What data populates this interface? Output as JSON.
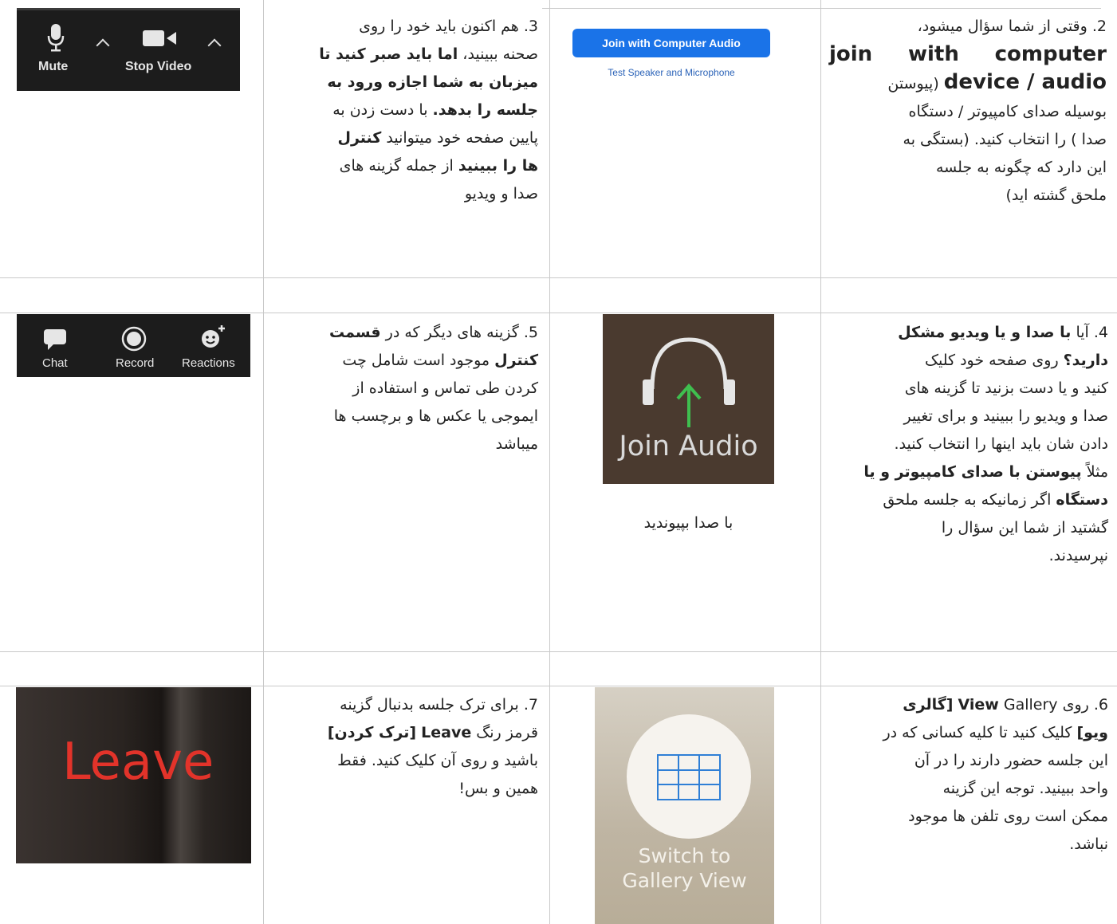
{
  "row1": {
    "step2_lines": [
      "2. وقتی از شما سؤال میشود،",
      "join with computer",
      "device / audio (پیوستن",
      "بوسیله صدای کامپیوتر / دستگاه",
      "صدا ) را انتخاب کنید. (بستگی به",
      "این دارد که چگونه به جلسه",
      "ملحق گشته اید)"
    ],
    "join_button": "Join with Computer Audio",
    "test_link": "Test Speaker and Microphone",
    "step3_lines": [
      "3. هم اکنون باید خود را روی",
      "صحنه ببینید، اما باید صبر کنید تا",
      "میزبان به شما اجازه ورود به",
      "جلسه را بدهد. با دست زدن به",
      "پایین صفحه خود میتوانید کنترل",
      "ها را ببینید از جمله گزینه های",
      "صدا و ویدیو"
    ],
    "toolbar": {
      "mute": "Mute",
      "stop_video": "Stop Video"
    }
  },
  "row2": {
    "step4_lines": [
      "4. آیا با صدا و یا ویدیو مشکل",
      "دارید؟ روی صفحه خود کلیک",
      "کنید و یا دست بزنید تا گزینه های",
      "صدا و ویدیو را ببینید و برای تغییر",
      "دادن شان باید اینها را انتخاب کنید.",
      "مثلاً پیوستن با صدای کامپیوتر و یا",
      "دستگاه اگر زمانیکه به جلسه ملحق",
      "گشتید از شما این سؤال را",
      "نپرسیدند."
    ],
    "join_audio": "Join Audio",
    "join_audio_caption": "با صدا بپیوندید",
    "step5_lines": [
      "5. گزینه های دیگر که در قسمت",
      "کنترل موجود است شامل چت",
      "کردن طی تماس و استفاده از",
      "ایموجی یا عکس ها و برچسب ها",
      "میباشد"
    ],
    "toolbar": {
      "chat": "Chat",
      "record": "Record",
      "reactions": "Reactions"
    }
  },
  "row3": {
    "step6_lines": [
      "6. روی Gallery View [گالری",
      "ویو] کلیک کنید تا کلیه کسانی که در",
      "این جلسه حضور دارند را در آن",
      "واحد ببینید. توجه این گزینه",
      "ممکن است روی تلفن ها موجود",
      "نباشد."
    ],
    "gallery_line1": "Switch to",
    "gallery_line2": "Gallery View",
    "step7_lines": [
      "7. برای ترک جلسه بدنبال گزینه",
      "قرمز رنگ Leave [ترک کردن]",
      "باشید و روی آن کلیک کنید. فقط",
      "همین و بس!"
    ],
    "leave": "Leave"
  }
}
